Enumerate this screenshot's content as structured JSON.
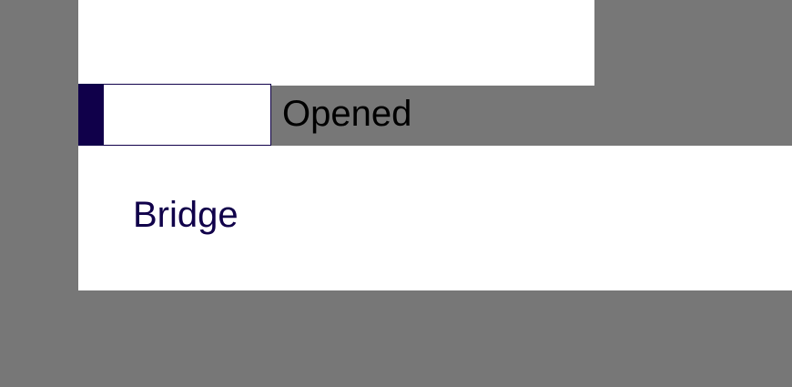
{
  "status": {
    "label": "Opened",
    "field_value": ""
  },
  "content": {
    "item_label": "Bridge"
  },
  "colors": {
    "background": "#777777",
    "accent": "#10004a",
    "panel": "#ffffff",
    "text": "#000000"
  }
}
